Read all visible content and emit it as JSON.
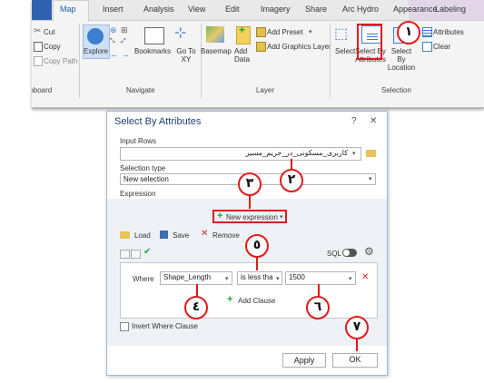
{
  "ribbon": {
    "tabs": [
      "Map",
      "Insert",
      "Analysis",
      "View",
      "Edit",
      "Imagery",
      "Share",
      "Arc Hydro",
      "Appearance",
      "Labeling"
    ],
    "clipboard": {
      "cut": "Cut",
      "copy": "Copy",
      "copy_path": "Copy Path",
      "group": "Clipboard"
    },
    "navigate": {
      "explore": "Explore",
      "bookmarks": "Bookmarks",
      "go_to_xy": "Go To XY",
      "group": "Navigate"
    },
    "layer": {
      "basemap": "Basemap",
      "add_data": "Add Data",
      "add_preset": "Add Preset",
      "add_graphics_layer": "Add Graphics Layer",
      "group": "Layer"
    },
    "selection": {
      "select": "Select",
      "select_by_attributes": "Select By Attributes",
      "select_by_location": "Select By Location",
      "attributes": "Attributes",
      "clear": "Clear",
      "group": "Selection"
    }
  },
  "dialog": {
    "title": "Select By Attributes",
    "help": "?",
    "close": "✕",
    "input_rows_label": "Input Rows",
    "input_rows_value": "کاربری_مسکونی_در_حریم_مسیر",
    "selection_type_label": "Selection type",
    "selection_type_value": "New selection",
    "expression_label": "Expression",
    "new_expression": "New expression",
    "load": "Load",
    "save": "Save",
    "remove": "Remove",
    "sql": "SQL",
    "clause": {
      "where": "Where",
      "field": "Shape_Length",
      "operator": "is less tha",
      "value": "1500"
    },
    "add_clause": "Add Clause",
    "invert_where_clause": "Invert Where Clause",
    "apply": "Apply",
    "ok": "OK"
  },
  "markers": [
    "١",
    "٢",
    "٣",
    "٤",
    "٥",
    "٦",
    "٧"
  ],
  "colors": {
    "marker_red": "#e01b1b",
    "accent_blue": "#1f5aa6",
    "file_tab": "#2e62b0",
    "add_green": "#2e9e3e"
  }
}
